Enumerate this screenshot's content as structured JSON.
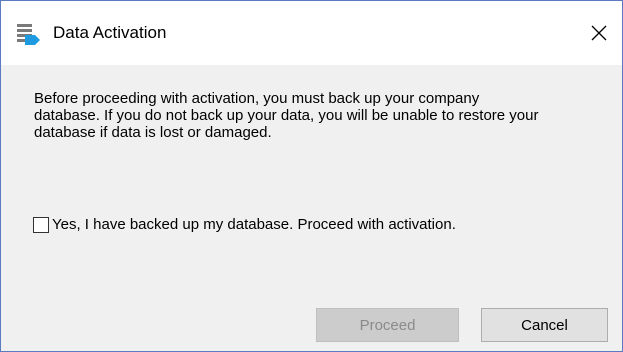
{
  "window": {
    "title": "Data Activation",
    "app_icon": "data-activation-app-icon",
    "close_icon": "close-icon"
  },
  "message": {
    "line1": "Before proceeding with activation, you must back up your company",
    "line2": "database. If you do not back up your data, you will be unable to restore your",
    "line3": "database if data is lost or damaged."
  },
  "confirm_checkbox": {
    "label": "Yes, I have backed up my database. Proceed with activation.",
    "checked": false
  },
  "buttons": {
    "proceed_label": "Proceed",
    "proceed_enabled": false,
    "cancel_label": "Cancel"
  },
  "colors": {
    "window_border": "#5a7bbd",
    "icon_gray": "#7a7a7a",
    "icon_blue": "#1e9be0",
    "disabled_button_bg": "#cccccc",
    "disabled_button_text": "#8a8a8a"
  }
}
